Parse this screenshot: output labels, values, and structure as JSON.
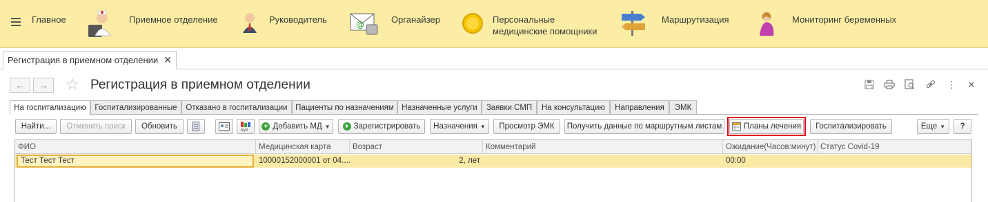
{
  "sections": {
    "main": "Главное",
    "reception": "Приемное отделение",
    "manager": "Руководитель",
    "organizer": "Органайзер",
    "assistants_line1": "Персональные",
    "assistants_line2": "медицинские помощники",
    "routing": "Маршрутизация",
    "pregnancy": "Мониторинг беременных"
  },
  "page_tab": {
    "label": "Регистрация в приемном отделении"
  },
  "form": {
    "title": "Регистрация в приемном отделении"
  },
  "tabs": [
    "На госпитализацию",
    "Госпитализированные",
    "Отказано в госпитализации",
    "Пациенты по назначениям",
    "Назначенные услуги",
    "Заявки СМП",
    "На консультацию",
    "Направления",
    "ЭМК"
  ],
  "toolbar": {
    "find": "Найти...",
    "cancel_search": "Отменить поиск",
    "refresh": "Обновить",
    "add_md": "Добавить МД",
    "register": "Зарегистрировать",
    "assignments": "Назначения",
    "view_emk": "Просмотр ЭМК",
    "get_route_data": "Получить данные по маршрутным листам",
    "treatment_plans": "Планы лечения",
    "hospitalize": "Госпитализировать",
    "more": "Еще",
    "help": "?"
  },
  "table": {
    "columns": [
      "ФИО",
      "Медицинская карта",
      "Возраст",
      "Комментарий",
      "Ожидание(Часов:минут)",
      "Статус Covid-19"
    ],
    "rows": [
      {
        "fio": "Тест Тест Тест",
        "card": "10000152000001 от 04....",
        "age": "2, лет",
        "comment": "",
        "waiting": "00:00",
        "covid": ""
      }
    ]
  },
  "colors": {
    "section_bar": "#fbeda4",
    "selected_row": "#fbeaa5",
    "highlight": "#e3001b"
  }
}
